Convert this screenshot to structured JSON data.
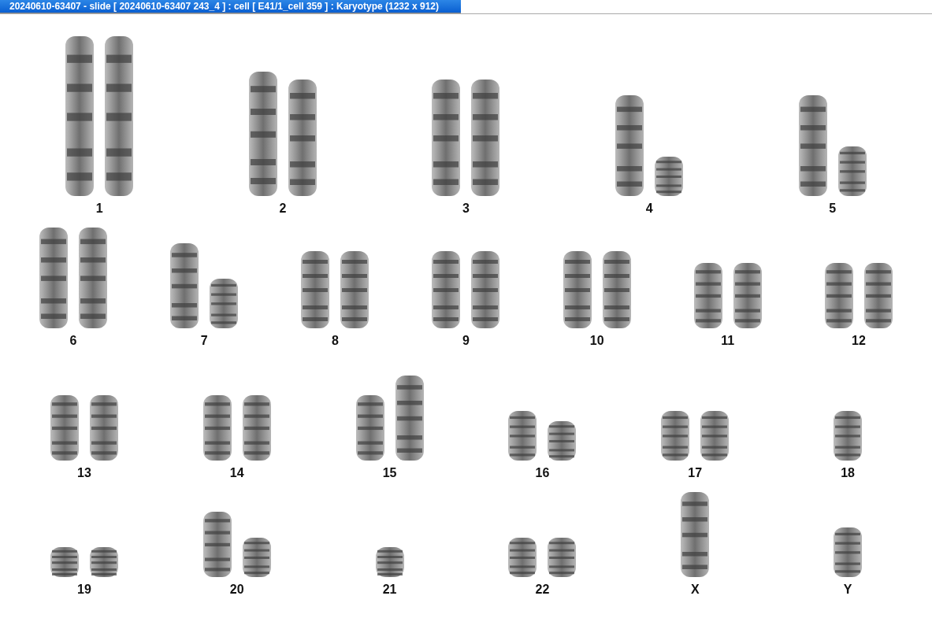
{
  "window": {
    "title": "20240610-63407 - slide [ 20240610-63407 243_4 ] : cell [ E41/1_cell 359 ] : Karyotype  (1232 x 912)"
  },
  "rows": [
    {
      "groups": [
        {
          "label": "1",
          "copies": [
            {
              "kind": "giant"
            },
            {
              "kind": "giant"
            }
          ]
        },
        {
          "label": "2",
          "copies": [
            {
              "kind": "huge"
            },
            {
              "kind": "large"
            }
          ]
        },
        {
          "label": "3",
          "copies": [
            {
              "kind": "large"
            },
            {
              "kind": "large"
            }
          ]
        },
        {
          "label": "4",
          "copies": [
            {
              "kind": "big"
            },
            {
              "kind": "tiny"
            }
          ]
        },
        {
          "label": "5",
          "copies": [
            {
              "kind": "big"
            },
            {
              "kind": "short"
            }
          ]
        }
      ]
    },
    {
      "groups": [
        {
          "label": "6",
          "copies": [
            {
              "kind": "big"
            },
            {
              "kind": "big"
            }
          ]
        },
        {
          "label": "7",
          "copies": [
            {
              "kind": "medium"
            },
            {
              "kind": "short"
            }
          ]
        },
        {
          "label": "8",
          "copies": [
            {
              "kind": "mid"
            },
            {
              "kind": "mid"
            }
          ]
        },
        {
          "label": "9",
          "copies": [
            {
              "kind": "mid"
            },
            {
              "kind": "mid"
            }
          ]
        },
        {
          "label": "10",
          "copies": [
            {
              "kind": "mid"
            },
            {
              "kind": "mid"
            }
          ]
        },
        {
          "label": "11",
          "copies": [
            {
              "kind": "small"
            },
            {
              "kind": "small"
            }
          ]
        },
        {
          "label": "12",
          "copies": [
            {
              "kind": "small"
            },
            {
              "kind": "small"
            }
          ]
        }
      ]
    },
    {
      "groups": [
        {
          "label": "13",
          "copies": [
            {
              "kind": "small"
            },
            {
              "kind": "small"
            }
          ]
        },
        {
          "label": "14",
          "copies": [
            {
              "kind": "small"
            },
            {
              "kind": "small"
            }
          ]
        },
        {
          "label": "15",
          "copies": [
            {
              "kind": "small"
            },
            {
              "kind": "medium"
            }
          ]
        },
        {
          "label": "16",
          "copies": [
            {
              "kind": "short"
            },
            {
              "kind": "tiny"
            }
          ]
        },
        {
          "label": "17",
          "copies": [
            {
              "kind": "short"
            },
            {
              "kind": "short"
            }
          ]
        },
        {
          "label": "18",
          "copies": [
            {
              "kind": "short"
            }
          ]
        }
      ]
    },
    {
      "groups": [
        {
          "label": "19",
          "copies": [
            {
              "kind": "mini"
            },
            {
              "kind": "mini"
            }
          ]
        },
        {
          "label": "20",
          "copies": [
            {
              "kind": "small"
            },
            {
              "kind": "tiny"
            }
          ]
        },
        {
          "label": "21",
          "copies": [
            {
              "kind": "mini"
            }
          ]
        },
        {
          "label": "22",
          "copies": [
            {
              "kind": "tiny"
            },
            {
              "kind": "tiny"
            }
          ]
        },
        {
          "label": "X",
          "copies": [
            {
              "kind": "medium"
            }
          ]
        },
        {
          "label": "Y",
          "copies": [
            {
              "kind": "short"
            }
          ]
        }
      ]
    }
  ]
}
